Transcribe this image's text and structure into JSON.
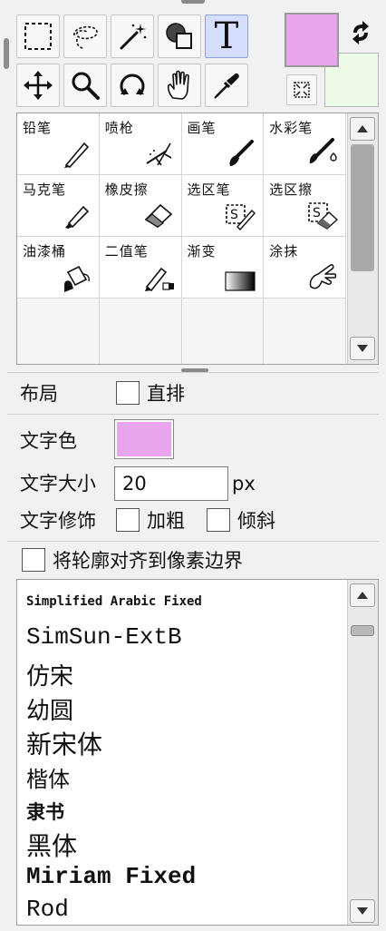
{
  "tools": [
    {
      "icon": "rect-select-icon",
      "active": false
    },
    {
      "icon": "lasso-select-icon",
      "active": false
    },
    {
      "icon": "magic-wand-icon",
      "active": false
    },
    {
      "icon": "shape-icon",
      "active": false
    },
    {
      "icon": "text-icon",
      "label": "T",
      "active": true
    },
    {
      "icon": "move-icon",
      "active": false
    },
    {
      "icon": "zoom-icon",
      "active": false
    },
    {
      "icon": "rotate-icon",
      "active": false
    },
    {
      "icon": "hand-icon",
      "active": false
    },
    {
      "icon": "eyedropper-icon",
      "active": false
    }
  ],
  "colors": {
    "foreground": "#e8a5ee",
    "background": "#eefae8",
    "text_color": "#e8a5ee",
    "active_tool_bg": "#d5defd"
  },
  "brushes": [
    {
      "label": "铅笔",
      "icon": "pencil-icon"
    },
    {
      "label": "喷枪",
      "icon": "airbrush-icon"
    },
    {
      "label": "画笔",
      "icon": "brush-icon"
    },
    {
      "label": "水彩笔",
      "icon": "watercolor-icon"
    },
    {
      "label": "马克笔",
      "icon": "marker-icon"
    },
    {
      "label": "橡皮擦",
      "icon": "eraser-icon"
    },
    {
      "label": "选区笔",
      "icon": "selection-pen-icon"
    },
    {
      "label": "选区擦",
      "icon": "selection-eraser-icon"
    },
    {
      "label": "油漆桶",
      "icon": "paint-bucket-icon"
    },
    {
      "label": "二值笔",
      "icon": "binary-pen-icon"
    },
    {
      "label": "渐变",
      "icon": "gradient-icon"
    },
    {
      "label": "涂抹",
      "icon": "smudge-icon"
    }
  ],
  "text_options": {
    "layout_label": "布局",
    "vertical_label": "直排",
    "color_label": "文字色",
    "size_label": "文字大小",
    "size_value": "20",
    "size_unit": "px",
    "decoration_label": "文字修饰",
    "bold_label": "加粗",
    "italic_label": "倾斜",
    "align_pixel_label": "将轮廓对齐到像素边界"
  },
  "fonts": [
    "Simplified Arabic Fixed",
    "SimSun-ExtB",
    "仿宋",
    "幼圆",
    "新宋体",
    "楷体",
    "隶书",
    "黑体",
    "Miriam Fixed",
    "Rod"
  ]
}
